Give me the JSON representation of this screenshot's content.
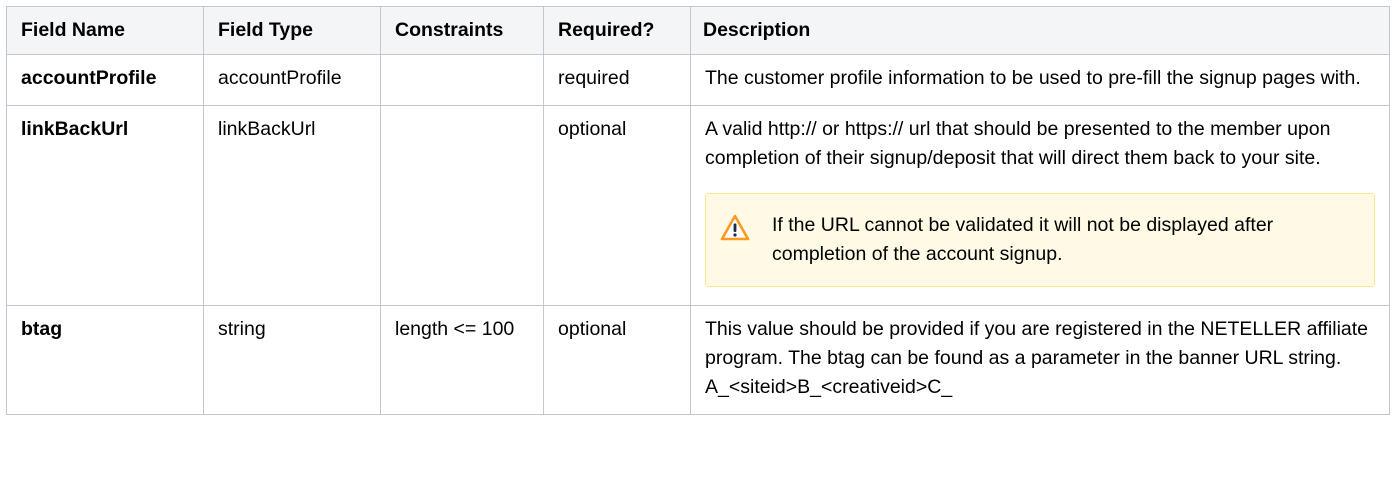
{
  "table": {
    "headers": {
      "field_name": "Field Name",
      "field_type": "Field Type",
      "constraints": "Constraints",
      "required": "Required?",
      "description": "Description"
    },
    "rows": [
      {
        "field_name": "accountProfile",
        "field_type": "accountProfile",
        "constraints": "",
        "required": "required",
        "description": "The customer profile information to be used to pre-fill the signup pages with."
      },
      {
        "field_name": "linkBackUrl",
        "field_type": "linkBackUrl",
        "constraints": "",
        "required": "optional",
        "description": "A valid http:// or https:// url that should be presented to the member upon completion of their signup/deposit that will direct them back to your site.",
        "warning": {
          "icon": "warning-icon",
          "text": "If the URL cannot be validated it will not be displayed after completion of the account signup."
        }
      },
      {
        "field_name": "btag",
        "field_type": "string",
        "constraints": "length <= 100",
        "required": "optional",
        "description": "This value should be provided if you are registered in the NETELLER affiliate program. The btag can be found as a parameter in the banner URL string. A_<siteid>B_<creativeid>C_"
      }
    ]
  },
  "colors": {
    "header_bg": "#f4f5f7",
    "border": "#c1c7d0",
    "warning_bg": "#fffae6",
    "warning_border": "#ffe58f",
    "warning_icon": "#ff991f"
  }
}
